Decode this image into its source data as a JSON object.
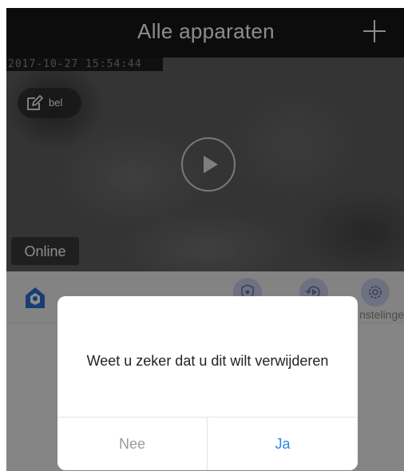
{
  "header": {
    "title": "Alle apparaten"
  },
  "camera": {
    "timestamp": "2017-10-27  15:54:44",
    "name_label": "bel",
    "status": "Online"
  },
  "toolbar": {
    "settings_label": "nstelinge"
  },
  "dialog": {
    "message": "Weet u zeker dat u dit wilt verwijderen",
    "cancel_label": "Nee",
    "confirm_label": "Ja"
  },
  "colors": {
    "header_bg": "#161616",
    "accent": "#2b86e8",
    "home_icon": "#2a6fd6",
    "tool_circle": "#c8cee8"
  },
  "icons": [
    "add-icon",
    "edit-icon",
    "play-icon",
    "home-icon",
    "shield-icon",
    "playback-icon",
    "settings-icon"
  ]
}
